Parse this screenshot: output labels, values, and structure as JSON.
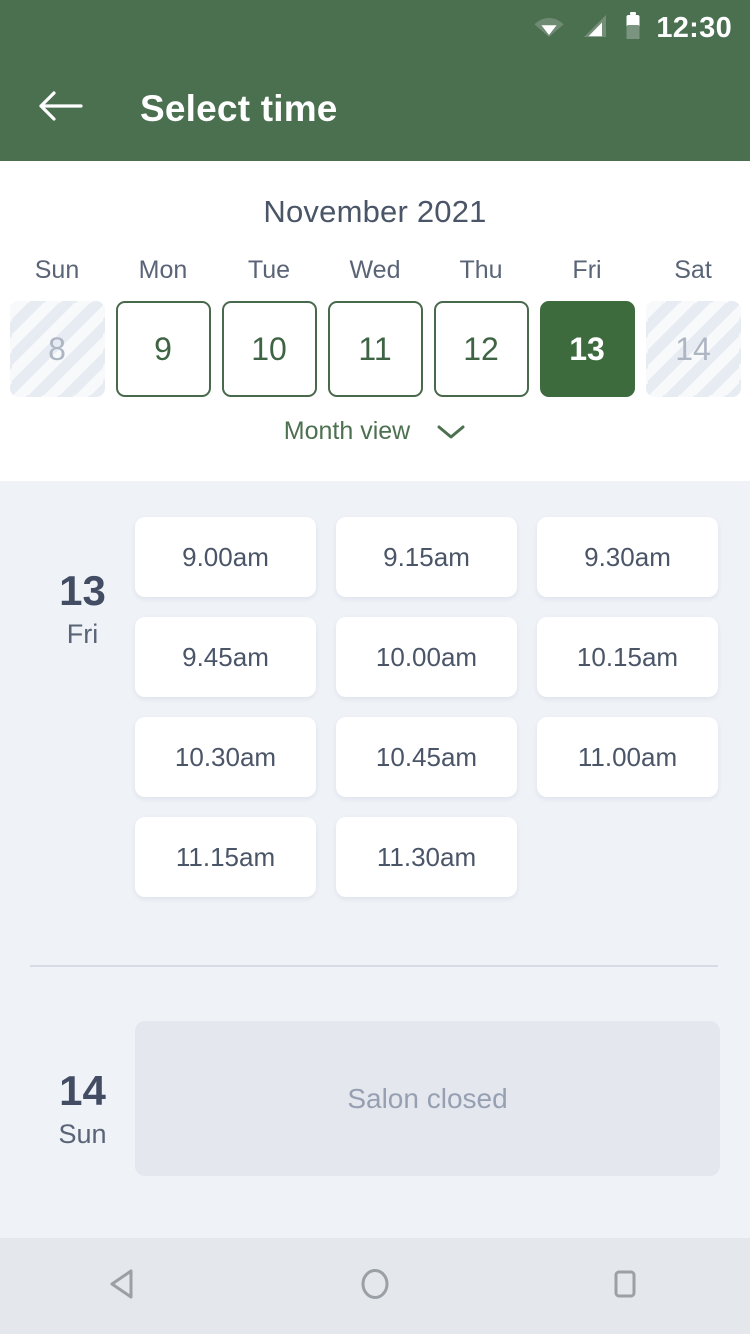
{
  "status_bar": {
    "time": "12:30",
    "icons": [
      "wifi-icon",
      "signal-icon",
      "battery-icon"
    ]
  },
  "app_bar": {
    "back_icon": "arrow-left-icon",
    "title": "Select time"
  },
  "calendar": {
    "month_title": "November 2021",
    "weekdays": [
      "Sun",
      "Mon",
      "Tue",
      "Wed",
      "Thu",
      "Fri",
      "Sat"
    ],
    "days": [
      {
        "label": "8",
        "state": "disabled"
      },
      {
        "label": "9",
        "state": "available"
      },
      {
        "label": "10",
        "state": "available"
      },
      {
        "label": "11",
        "state": "available"
      },
      {
        "label": "12",
        "state": "available"
      },
      {
        "label": "13",
        "state": "selected"
      },
      {
        "label": "14",
        "state": "disabled"
      }
    ],
    "view_toggle": {
      "label": "Month view",
      "icon": "chevron-down-icon"
    }
  },
  "slot_groups": [
    {
      "date_number": "13",
      "day_of_week": "Fri",
      "slots": [
        "9.00am",
        "9.15am",
        "9.30am",
        "9.45am",
        "10.00am",
        "10.15am",
        "10.30am",
        "10.45am",
        "11.00am",
        "11.15am",
        "11.30am"
      ]
    },
    {
      "date_number": "14",
      "day_of_week": "Sun",
      "closed_message": "Salon closed"
    }
  ],
  "nav_bar": {
    "back": "nav-back-icon",
    "home": "nav-home-icon",
    "recents": "nav-recents-icon"
  },
  "colors": {
    "brand_green": "#4a7050",
    "selected_green": "#3d6b3e",
    "outline_green": "#49694c",
    "slate": "#4a5568",
    "page_bg": "#eff2f7",
    "nav_bg": "#e4e7eb",
    "closed_card": "#e4e8ee"
  }
}
